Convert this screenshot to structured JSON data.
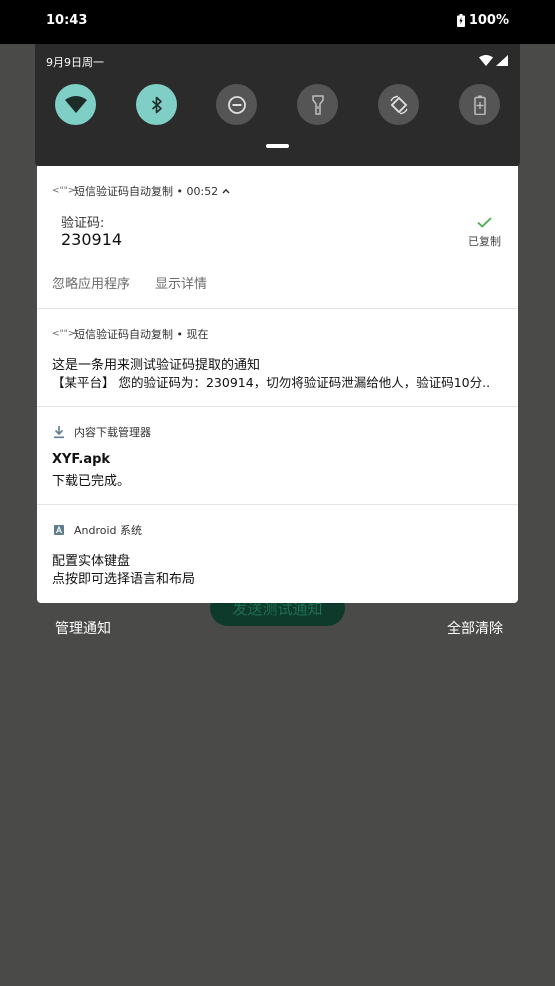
{
  "status_bar": {
    "time": "10:43",
    "battery_text": "100%"
  },
  "quick_settings": {
    "date": "9月9日周一",
    "tiles": [
      {
        "name": "wifi",
        "state": "on"
      },
      {
        "name": "bluetooth",
        "state": "on"
      },
      {
        "name": "do-not-disturb",
        "state": "off"
      },
      {
        "name": "flashlight",
        "state": "off"
      },
      {
        "name": "auto-rotate",
        "state": "off"
      },
      {
        "name": "battery-saver",
        "state": "off"
      }
    ]
  },
  "background_app": {
    "send_button_label": "发送测试通知"
  },
  "notifications": [
    {
      "app": "短信验证码自动复制",
      "time": "00:52",
      "label": "验证码:",
      "code": "230914",
      "copied_label": "已复制",
      "actions": [
        "忽略应用程序",
        "显示详情"
      ]
    },
    {
      "app": "短信验证码自动复制",
      "time": "现在",
      "title": "这是一条用来测试验证码提取的通知",
      "text": "【某平台】 您的验证码为：230914，切勿将验证码泄漏给他人，验证码10分.."
    },
    {
      "app": "内容下载管理器",
      "title": "XYF.apk",
      "text": "下载已完成。"
    },
    {
      "app": "Android 系统",
      "title": "配置实体键盘",
      "text": "点按即可选择语言和布局"
    }
  ],
  "shade_actions": {
    "manage": "管理通知",
    "clear_all": "全部清除"
  },
  "colors": {
    "accent": "#7fcfc6",
    "check": "#4caf50"
  }
}
